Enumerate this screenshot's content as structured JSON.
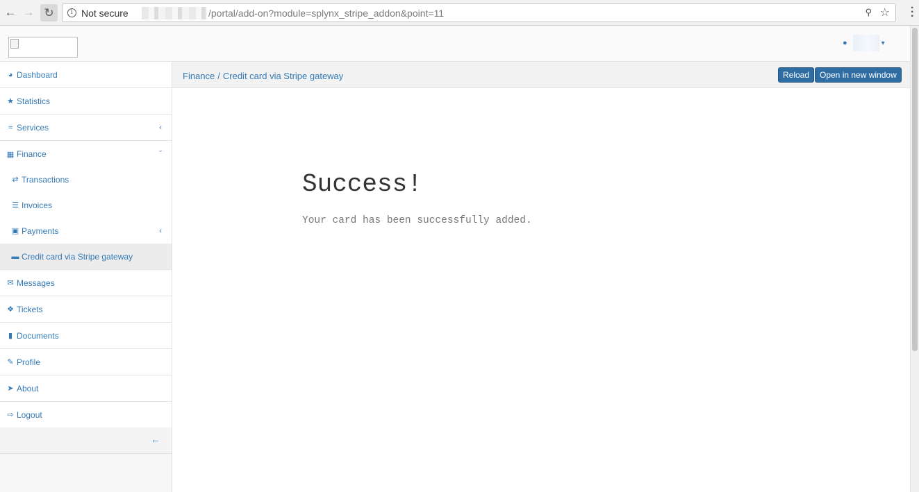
{
  "browser": {
    "security_label": "Not secure",
    "url_path": "/portal/add-on?module=splynx_stripe_addon&point=11"
  },
  "header": {
    "user_caret": "▾"
  },
  "sidebar": {
    "items": [
      {
        "label": "Dashboard",
        "icon": "dashboard-icon"
      },
      {
        "label": "Statistics",
        "icon": "star-icon"
      },
      {
        "label": "Services",
        "icon": "wifi-icon"
      },
      {
        "label": "Finance",
        "icon": "calculator-icon"
      },
      {
        "label": "Transactions",
        "icon": "exchange-icon"
      },
      {
        "label": "Invoices",
        "icon": "list-icon"
      },
      {
        "label": "Payments",
        "icon": "archive-icon"
      },
      {
        "label": "Credit card via Stripe gateway",
        "icon": "credit-card-icon"
      },
      {
        "label": "Messages",
        "icon": "envelope-icon"
      },
      {
        "label": "Tickets",
        "icon": "ticket-icon"
      },
      {
        "label": "Documents",
        "icon": "file-icon"
      },
      {
        "label": "Profile",
        "icon": "pencil-icon"
      },
      {
        "label": "About",
        "icon": "rocket-icon"
      },
      {
        "label": "Logout",
        "icon": "sign-out-icon"
      }
    ]
  },
  "breadcrumb": {
    "section": "Finance",
    "separator": "/",
    "page": "Credit card via Stripe gateway"
  },
  "toolbar": {
    "reload_label": "Reload",
    "open_new_window_label": "Open in new window"
  },
  "content": {
    "title": "Success!",
    "message": "Your card has been successfully added."
  },
  "colors": {
    "link": "#337ab7",
    "button": "#2e6da4"
  }
}
